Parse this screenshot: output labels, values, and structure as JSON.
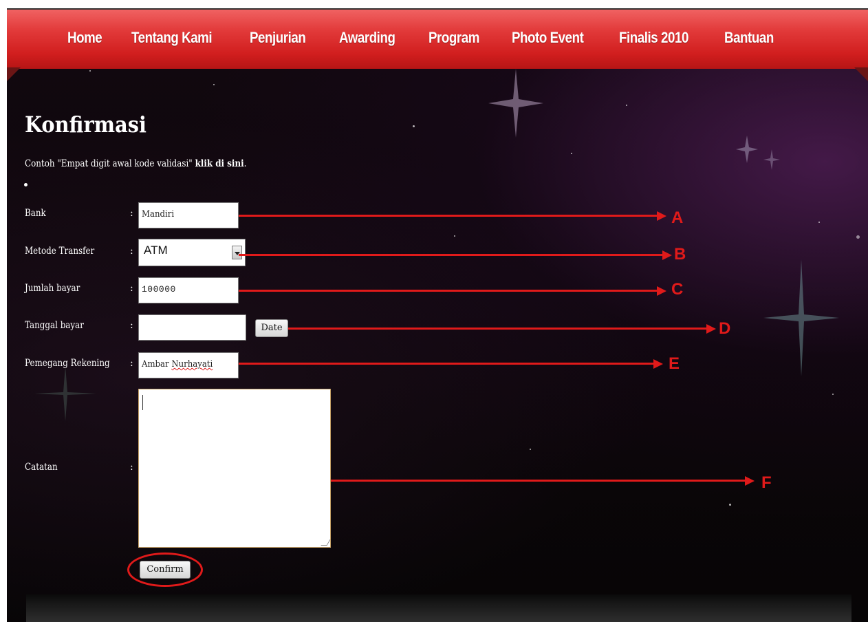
{
  "nav": {
    "items": [
      "Home",
      "Tentang Kami",
      "Penjurian",
      "Awarding",
      "Program",
      "Photo Event",
      "Finalis 2010",
      "Bantuan"
    ]
  },
  "page": {
    "title": "Konfirmasi",
    "intro_text": "Contoh \"Empat digit awal kode validasi\"",
    "intro_link": "klik di sini",
    "intro_end": "."
  },
  "form": {
    "bank_label": "Bank",
    "bank_value": "Mandiri",
    "method_label": "Metode Transfer",
    "method_value": "ATM",
    "amount_label": "Jumlah bayar",
    "amount_value": "100000",
    "date_label": "Tanggal bayar",
    "date_value": "",
    "date_button": "Date",
    "holder_label": "Pemegang Rekening",
    "holder_first": "Ambar",
    "holder_last": "Nurhayati",
    "notes_label": "Catatan",
    "notes_value": "",
    "colon": ":",
    "confirm_button": "Confirm"
  },
  "annotations": {
    "a": "A",
    "b": "B",
    "c": "C",
    "d": "D",
    "e": "E",
    "f": "F",
    "color": "#e01a1a"
  },
  "colors": {
    "nav_bar": "#d11e1e",
    "background": "#0b0508"
  }
}
